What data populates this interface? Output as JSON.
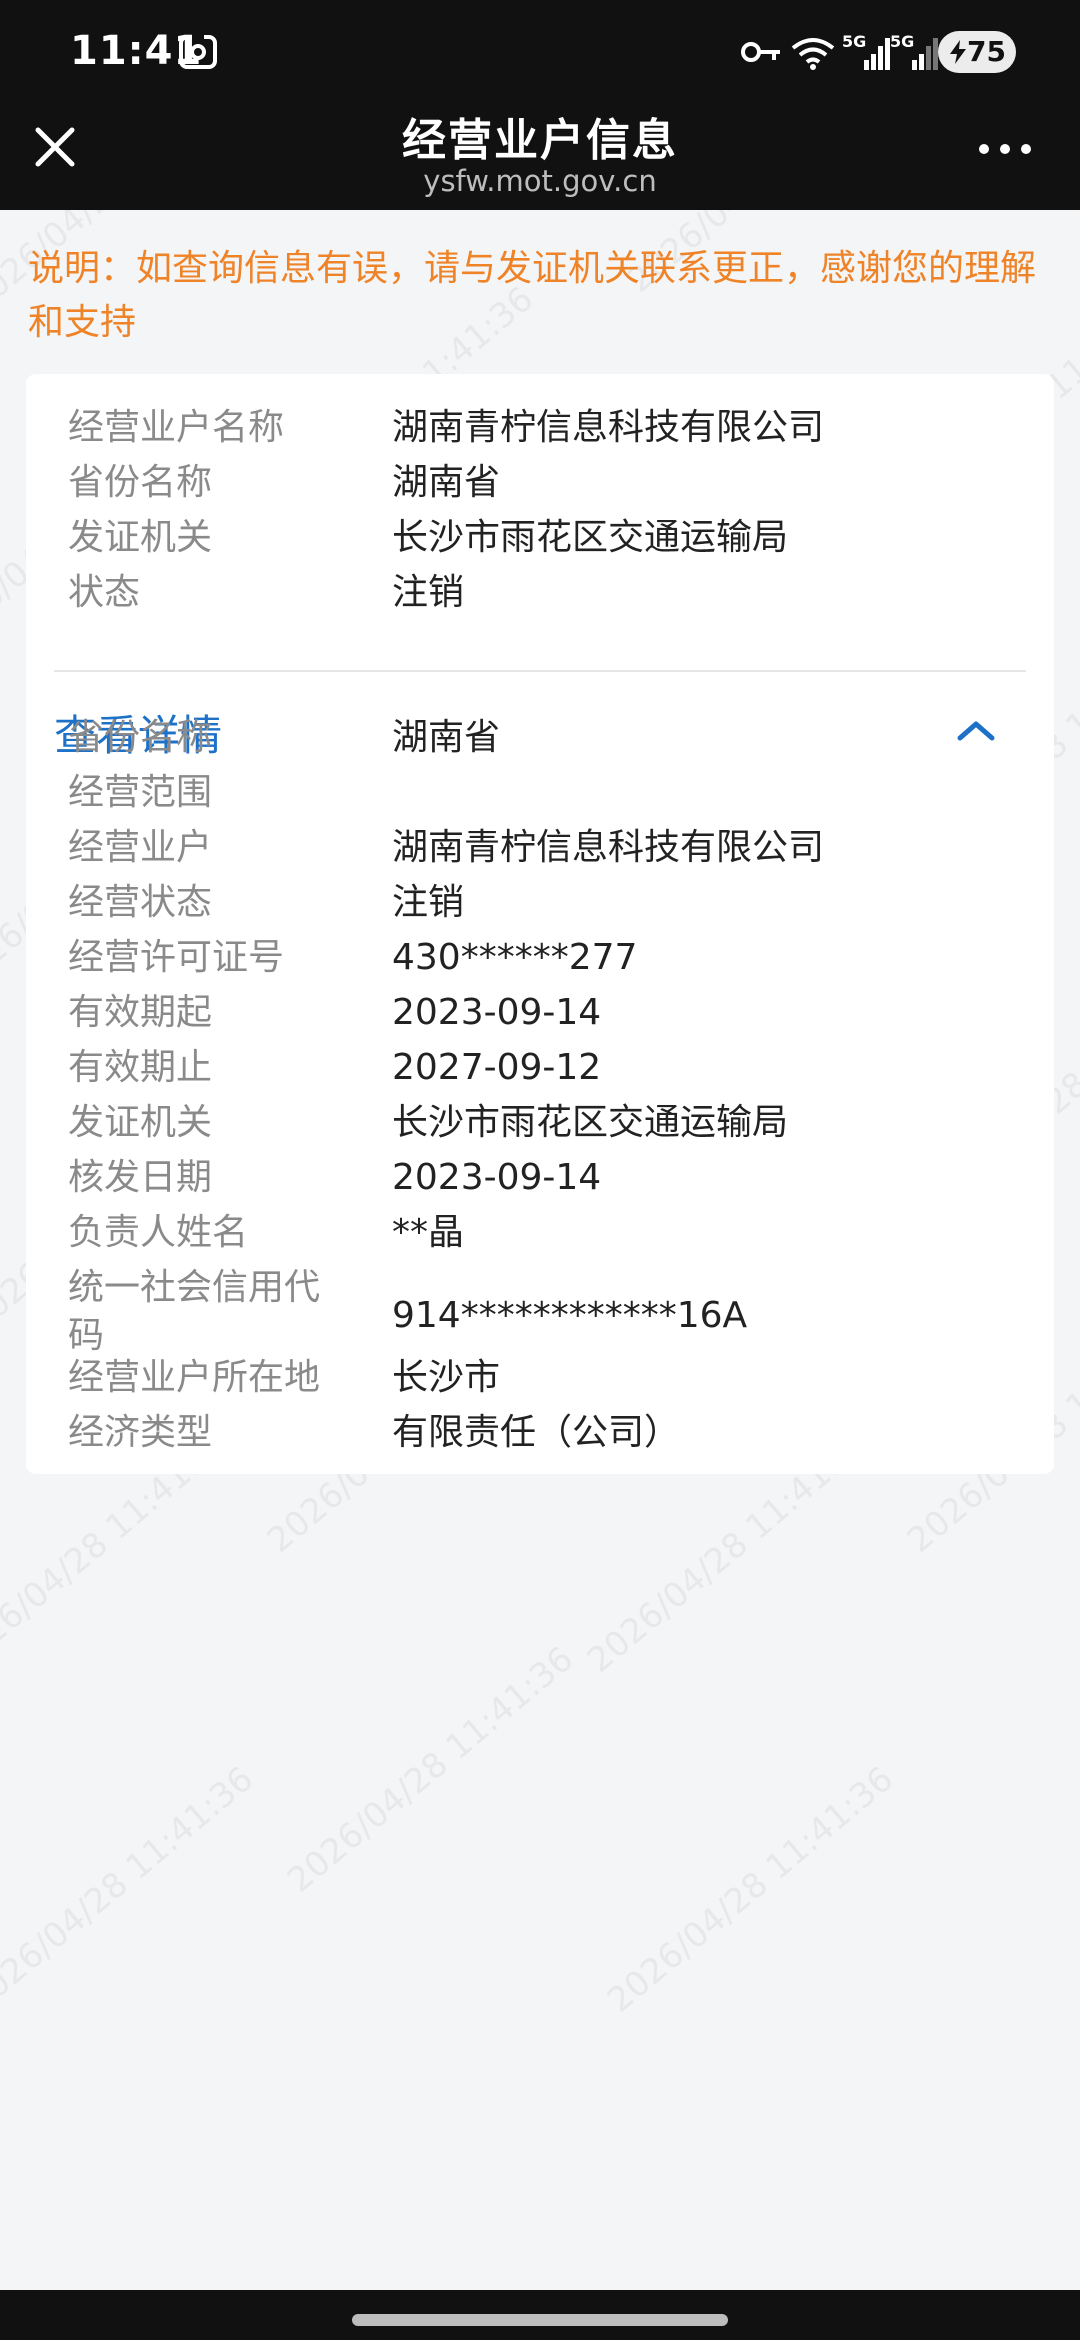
{
  "status_bar": {
    "time": "11:41",
    "network_5g_1": "5G",
    "network_5g_2": "5G",
    "battery": "75"
  },
  "nav": {
    "title": "经营业户信息",
    "subtitle": "ysfw.mot.gov.cn"
  },
  "notice": "说明：如查询信息有误，请与发证机关联系更正，感谢您的理解和支持",
  "summary": [
    {
      "label": "经营业户名称",
      "value": "湖南青柠信息科技有限公司"
    },
    {
      "label": "省份名称",
      "value": "湖南省"
    },
    {
      "label": "发证机关",
      "value": "长沙市雨花区交通运输局"
    },
    {
      "label": "状态",
      "value": "注销"
    }
  ],
  "details_toggle": "查看详情",
  "details": [
    {
      "label": "省份名称",
      "value": "湖南省"
    },
    {
      "label": "经营范围",
      "value": ""
    },
    {
      "label": "经营业户",
      "value": "湖南青柠信息科技有限公司"
    },
    {
      "label": "经营状态",
      "value": "注销"
    },
    {
      "label": "经营许可证号",
      "value": "430******277"
    },
    {
      "label": "有效期起",
      "value": "2023-09-14"
    },
    {
      "label": "有效期止",
      "value": "2027-09-12"
    },
    {
      "label": "发证机关",
      "value": "长沙市雨花区交通运输局"
    },
    {
      "label": "核发日期",
      "value": "2023-09-14"
    },
    {
      "label": "负责人姓名",
      "value": "**晶"
    },
    {
      "label": "统一社会信用代码",
      "value": "914************16A"
    },
    {
      "label": "经营业户所在地",
      "value": "长沙市"
    },
    {
      "label": "经济类型",
      "value": "有限责任（公司）"
    }
  ],
  "watermark": "2026/04/28 11:41:36",
  "colors": {
    "accent": "#1d72c8",
    "notice": "#ee8328",
    "label": "#8a8a8a"
  }
}
